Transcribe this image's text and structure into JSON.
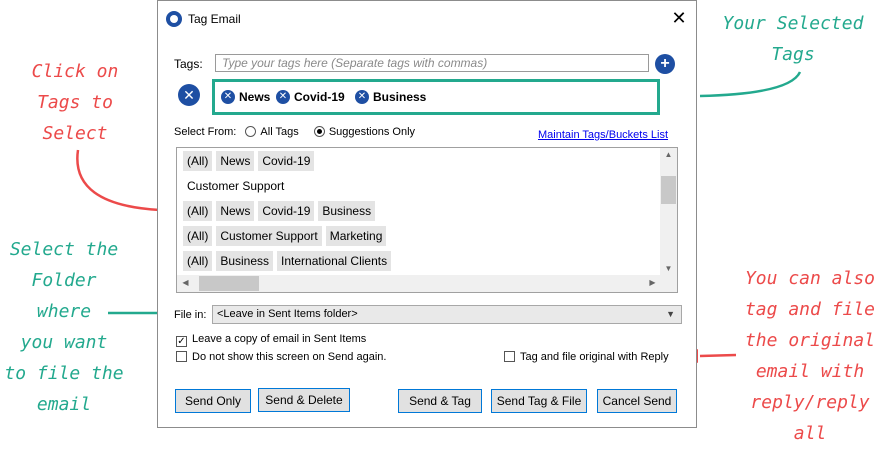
{
  "dialog": {
    "title": "Tag Email",
    "tags_label": "Tags:",
    "tags_placeholder": "Type your tags here (Separate tags with commas)",
    "selected_tags": [
      "News",
      "Covid-19",
      "Business"
    ],
    "select_from_label": "Select From:",
    "radio_all": "All Tags",
    "radio_suggestions": "Suggestions Only",
    "maintain_link": "Maintain Tags/Buckets List",
    "suggestions": [
      [
        "(All)",
        "News",
        "Covid-19"
      ],
      [
        "Customer Support"
      ],
      [
        "(All)",
        "News",
        "Covid-19",
        "Business"
      ],
      [
        "(All)",
        "Customer Support",
        "Marketing"
      ],
      [
        "(All)",
        "Business",
        "International Clients"
      ]
    ],
    "file_in_label": "File in:",
    "file_in_value": "<Leave in Sent Items folder>",
    "check_leave_copy": "Leave a copy of email in Sent Items",
    "check_leave_copy_checked": true,
    "check_dont_show": "Do not show this screen on Send again.",
    "check_tag_original": "Tag and file original with Reply",
    "buttons": {
      "send_only": "Send Only",
      "send_delete": "Send & Delete",
      "send_tag": "Send & Tag",
      "send_tag_file": "Send Tag & File",
      "cancel_send": "Cancel Send"
    }
  },
  "annotations": {
    "selected_tags": [
      "Your Selected",
      "Tags"
    ],
    "click_tags": [
      "Click on",
      "Tags to",
      "Select"
    ],
    "select_folder": [
      "Select the",
      "Folder",
      "where",
      "you want",
      "to file the",
      "email"
    ],
    "tag_original": [
      "You can also",
      "tag and file",
      "the original",
      "email with",
      "reply/reply",
      "all"
    ]
  },
  "colors": {
    "red": "#ec4a4a",
    "teal": "#23a98e",
    "blue": "#1e4fa3"
  }
}
